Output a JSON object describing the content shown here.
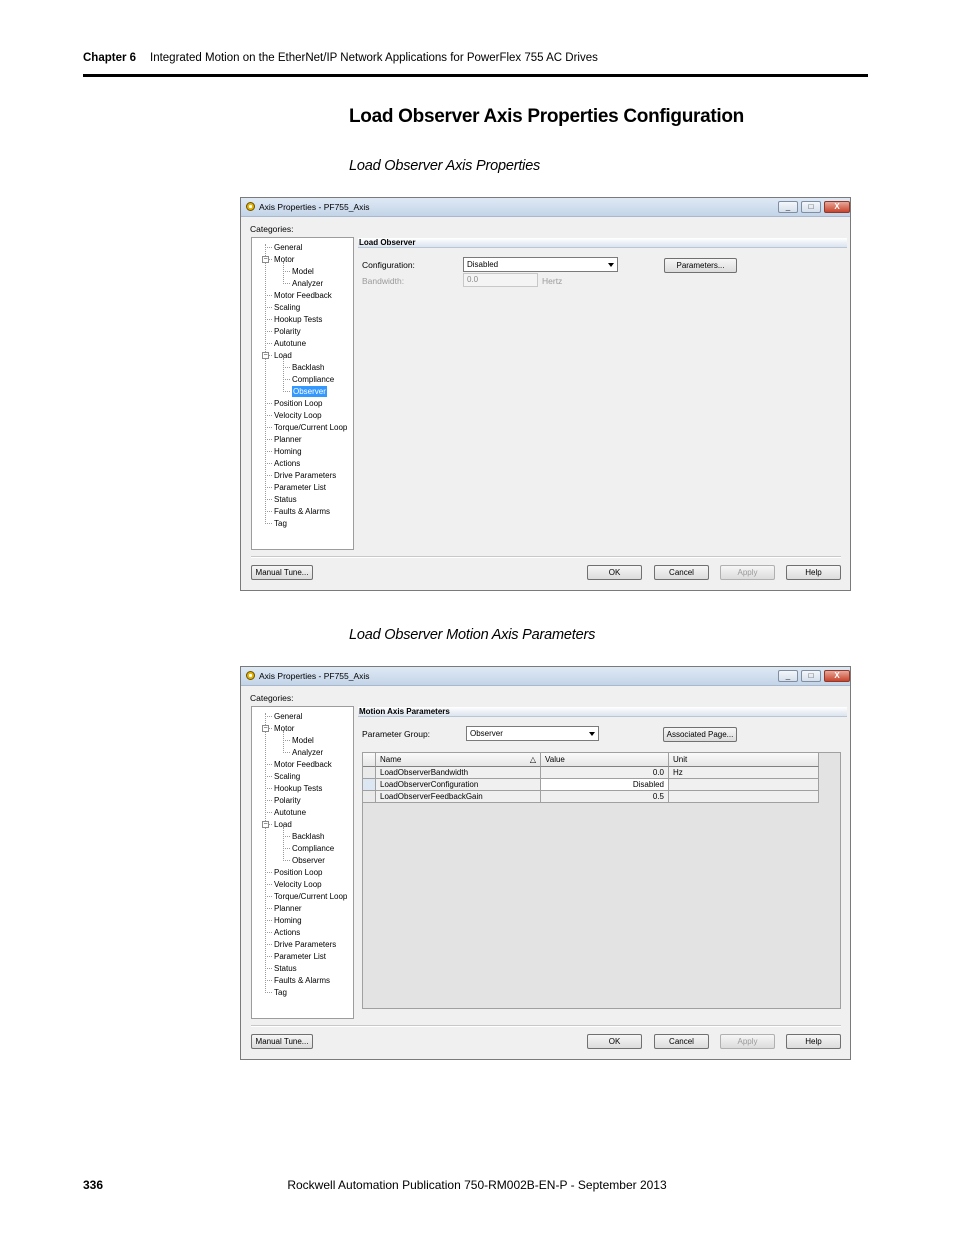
{
  "header": {
    "chapter": "Chapter 6",
    "title": "Integrated Motion on the EtherNet/IP Network Applications for PowerFlex 755 AC Drives"
  },
  "section_title": "Load Observer Axis Properties Configuration",
  "captions": {
    "first": "Load Observer Axis Properties",
    "second": "Load Observer Motion Axis Parameters"
  },
  "dialog": {
    "title": "Axis Properties - PF755_Axis",
    "window_buttons": [
      "_",
      "□",
      "X"
    ],
    "categories_label": "Categories:",
    "tree": [
      "General",
      "Motor",
      "Model",
      "Analyzer",
      "Motor Feedback",
      "Scaling",
      "Hookup Tests",
      "Polarity",
      "Autotune",
      "Load",
      "Backlash",
      "Compliance",
      "Observer",
      "Position Loop",
      "Velocity Loop",
      "Torque/Current Loop",
      "Planner",
      "Homing",
      "Actions",
      "Drive Parameters",
      "Parameter List",
      "Status",
      "Faults & Alarms",
      "Tag"
    ],
    "buttons": {
      "manual_tune": "Manual Tune...",
      "ok": "OK",
      "cancel": "Cancel",
      "apply": "Apply",
      "help": "Help"
    }
  },
  "dialog1": {
    "section": "Load Observer",
    "configuration_label": "Configuration:",
    "configuration_value": "Disabled",
    "bandwidth_label": "Bandwidth:",
    "bandwidth_value": "0.0",
    "bandwidth_unit": "Hertz",
    "parameters_button": "Parameters..."
  },
  "dialog2": {
    "section": "Motion Axis Parameters",
    "group_label": "Parameter Group:",
    "group_value": "Observer",
    "associated_button": "Associated Page...",
    "columns": [
      "Name",
      "Value",
      "Unit"
    ],
    "rows": [
      {
        "name": "LoadObserverBandwidth",
        "value": "0.0",
        "unit": "Hz"
      },
      {
        "name": "LoadObserverConfiguration",
        "value": "Disabled",
        "unit": ""
      },
      {
        "name": "LoadObserverFeedbackGain",
        "value": "0.5",
        "unit": ""
      }
    ]
  },
  "footer": {
    "page_number": "336",
    "publication": "Rockwell Automation Publication 750-RM002B-EN-P - September 2013"
  }
}
